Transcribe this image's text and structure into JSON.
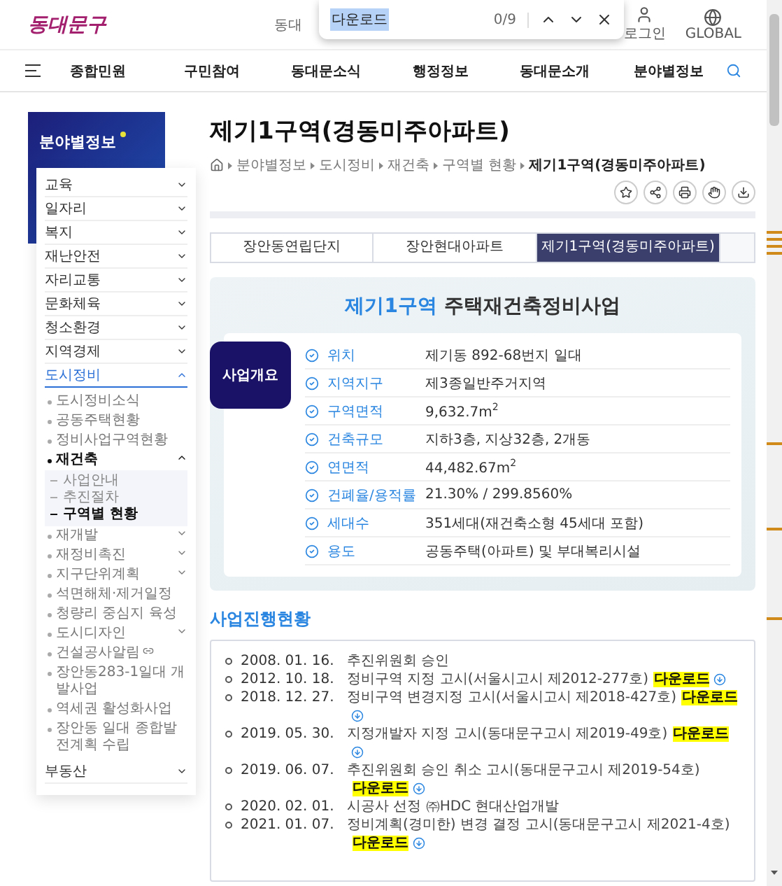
{
  "header": {
    "logo": "동대문구",
    "search_hint": "동대",
    "login": "로그인",
    "global": "GLOBAL"
  },
  "find_bar": {
    "query": "다운로드",
    "count": "0/9"
  },
  "nav": {
    "items": [
      "종합민원",
      "구민참여",
      "동대문소식",
      "행정정보",
      "동대문소개",
      "분야별정보"
    ]
  },
  "sidebar": {
    "title": "분야별정보",
    "items": [
      {
        "label": "교육",
        "expanded": false
      },
      {
        "label": "일자리",
        "expanded": false
      },
      {
        "label": "복지",
        "expanded": false
      },
      {
        "label": "재난안전",
        "expanded": false
      },
      {
        "label": "자리교통",
        "expanded": false
      },
      {
        "label": "문화체육",
        "expanded": false
      },
      {
        "label": "청소환경",
        "expanded": false
      },
      {
        "label": "지역경제",
        "expanded": false
      },
      {
        "label": "도시정비",
        "expanded": true,
        "children": [
          {
            "label": "도시정비소식",
            "kind": "page",
            "selected": false
          },
          {
            "label": "공동주택현황",
            "kind": "page",
            "selected": false
          },
          {
            "label": "정비사업구역현황",
            "kind": "page",
            "selected": false
          },
          {
            "label": "재건축",
            "kind": "group",
            "selected": true,
            "expanded": true,
            "children": [
              {
                "label": "사업안내",
                "selected": false
              },
              {
                "label": "추진절차",
                "selected": false
              },
              {
                "label": "구역별 현황",
                "selected": true
              }
            ]
          },
          {
            "label": "재개발",
            "kind": "group",
            "selected": false,
            "expanded": false
          },
          {
            "label": "재정비촉진",
            "kind": "group",
            "selected": false,
            "expanded": false
          },
          {
            "label": "지구단위계획",
            "kind": "group",
            "selected": false,
            "expanded": false
          },
          {
            "label": "석면해체·제거일정",
            "kind": "page",
            "selected": false
          },
          {
            "label": "청량리 중심지 육성",
            "kind": "page",
            "selected": false
          },
          {
            "label": "도시디자인",
            "kind": "group",
            "selected": false,
            "expanded": false
          },
          {
            "label": "건설공사알림",
            "kind": "link",
            "selected": false
          },
          {
            "label": "장안동283-1일대 개발사업",
            "kind": "page",
            "selected": false
          },
          {
            "label": "역세권 활성화사업",
            "kind": "page",
            "selected": false
          },
          {
            "label": "장안동 일대 종합발전계획 수립",
            "kind": "page",
            "selected": false
          }
        ]
      },
      {
        "label": "부동산",
        "expanded": false
      }
    ]
  },
  "page": {
    "title": "제기1구역(경동미주아파트)",
    "breadcrumb": [
      "분야별정보",
      "도시정비",
      "재건축",
      "구역별 현황",
      "제기1구역(경동미주아파트)"
    ],
    "tabs": [
      {
        "label": "장안동연립단지",
        "selected": false
      },
      {
        "label": "장안현대아파트",
        "selected": false
      },
      {
        "label": "제기1구역(경동미주아파트)",
        "selected": true
      }
    ]
  },
  "overview": {
    "title_highlight": "제기1구역",
    "title": "주택재건축정비사업",
    "badge": "사업개요",
    "rows": [
      {
        "label": "위치",
        "value": "제기동 892-68번지 일대"
      },
      {
        "label": "지역지구",
        "value": "제3종일반주거지역"
      },
      {
        "label": "구역면적",
        "value": "9,632.7m$^{2}$"
      },
      {
        "label": "건축규모",
        "value": "지하3층, 지상32층, 2개동"
      },
      {
        "label": "연면적",
        "value": "44,482.67m$^{2}$"
      },
      {
        "label": "건폐율/용적률",
        "value": "21.30% / 299.8560%"
      },
      {
        "label": "세대수",
        "value": "351세대(재건축소형 45세대 포함)"
      },
      {
        "label": "용도",
        "value": "공동주택(아파트) 및 부대복리시설"
      }
    ]
  },
  "history": {
    "title": "사업진행현황",
    "rows": [
      {
        "date": "2008. 01. 16.",
        "text": "추진위원회 승인"
      },
      {
        "date": "2012. 10. 18.",
        "text": "정비구역 지정 고시(서울시고시 제2012-277호)",
        "download": "다운로드"
      },
      {
        "date": "2018. 12. 27.",
        "text": "정비구역 변경지정 고시(서울시고시 제2018-427호)",
        "download": "다운로드"
      },
      {
        "date": "2019. 05. 30.",
        "text": "지정개발자 지정 고시(동대문구고시 제2019-49호)",
        "download": "다운로드"
      },
      {
        "date": "2019. 06. 07.",
        "text": "추진위원회 승인 취소 고시(동대문구고시 제2019-54호)",
        "download": "다운로드"
      },
      {
        "date": "2020. 02. 01.",
        "text": "시공사 선정 ㈜HDC 현대산업개발"
      },
      {
        "date": "2021. 01. 07.",
        "text": "정비계획(경미한) 변경 결정 고시(동대문구고시 제2021-4호)",
        "download": "다운로드"
      }
    ]
  }
}
